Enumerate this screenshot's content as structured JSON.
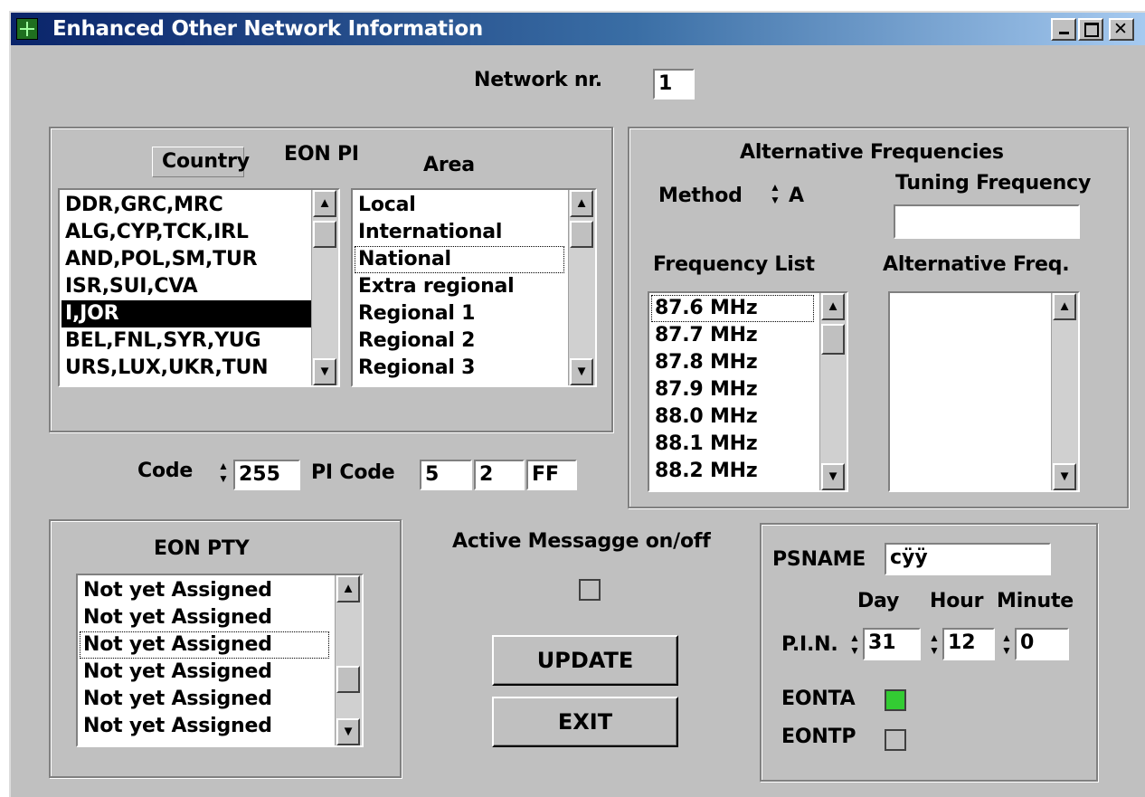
{
  "window": {
    "title": "Enhanced Other Network Information"
  },
  "network": {
    "label": "Network nr.",
    "value": "1"
  },
  "eon_pi": {
    "heading": "EON PI",
    "country_label": "Country",
    "area_label": "Area",
    "countries": [
      "DDR,GRC,MRC",
      "ALG,CYP,TCK,IRL",
      "AND,POL,SM,TUR",
      "ISR,SUI,CVA",
      "I,JOR",
      "BEL,FNL,SYR,YUG",
      "URS,LUX,UKR,TUN"
    ],
    "selected_country_index": 4,
    "areas": [
      "Local",
      "International",
      "National",
      "Extra regional",
      "Regional 1",
      "Regional 2",
      "Regional 3"
    ],
    "focused_area_index": 2
  },
  "code": {
    "label": "Code",
    "value": "255",
    "pi_label": "PI Code",
    "pi_values": [
      "5",
      "2",
      "FF"
    ]
  },
  "af": {
    "heading": "Alternative Frequencies",
    "method_label": "Method",
    "method_value": "A",
    "tuning_label": "Tuning Frequency",
    "tuning_value": "",
    "freq_list_label": "Frequency List",
    "alt_freq_label": "Alternative Freq.",
    "frequencies": [
      "87.6 MHz",
      "87.7 MHz",
      "87.8 MHz",
      "87.9 MHz",
      "88.0 MHz",
      "88.1 MHz",
      "88.2 MHz"
    ]
  },
  "eon_pty": {
    "heading": "EON PTY",
    "items": [
      "Not yet Assigned",
      "Not yet Assigned",
      "Not yet Assigned",
      "Not yet Assigned",
      "Not yet Assigned",
      "Not yet Assigned"
    ],
    "focused_index": 2
  },
  "active_message": {
    "label": "Active Messagge on/off",
    "checked": false
  },
  "buttons": {
    "update": "UPDATE",
    "exit": "EXIT"
  },
  "ps": {
    "psname_label": "PSNAME",
    "psname_value": "cÿÿ",
    "day_label": "Day",
    "hour_label": "Hour",
    "minute_label": "Minute",
    "pin_label": "P.I.N.",
    "day_value": "31",
    "hour_value": "12",
    "minute_value": "0",
    "eonta_label": "EONTA",
    "eonta_checked": true,
    "eontp_label": "EONTP",
    "eontp_checked": false
  },
  "colors": {
    "titlebar_start": "#0a246a",
    "face": "#c0c0c0",
    "eonta_on": "#33cc33"
  },
  "icons": {
    "up": "▲",
    "down": "▼"
  }
}
